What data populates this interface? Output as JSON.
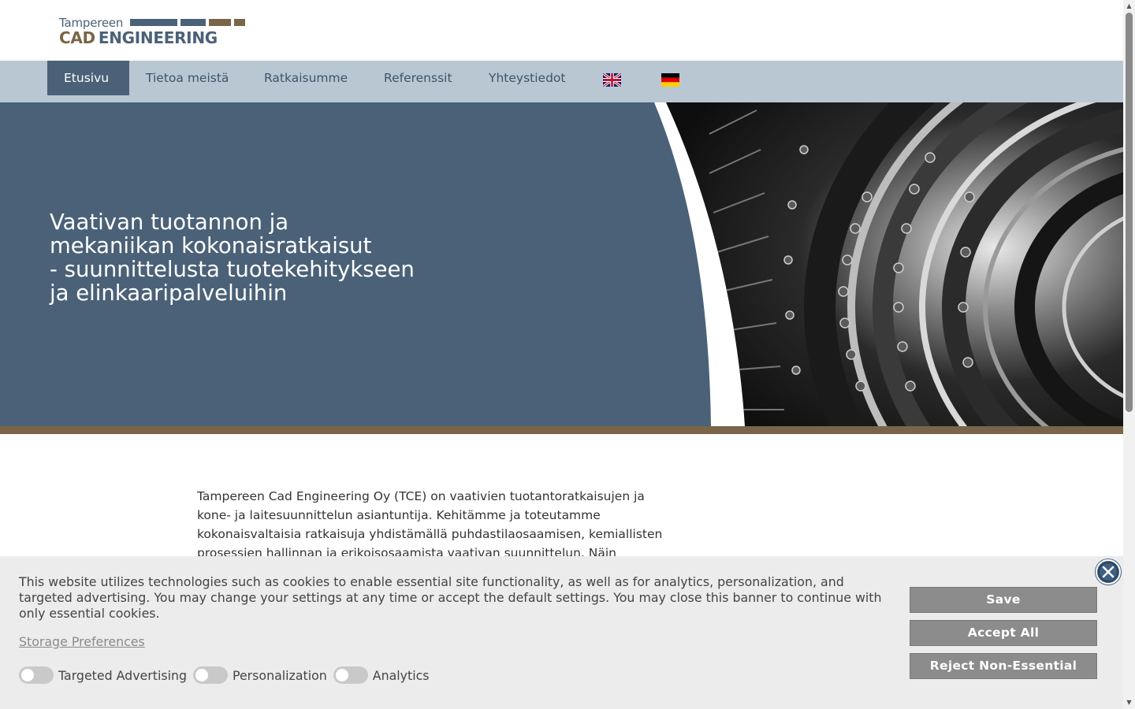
{
  "header": {
    "logo_line1": "Tampereen",
    "logo_cad": "CAD",
    "logo_engineering": "ENGINEERING"
  },
  "nav": {
    "items": [
      {
        "label": "Etusivu",
        "active": true
      },
      {
        "label": "Tietoa meistä",
        "active": false
      },
      {
        "label": "Ratkaisumme",
        "active": false
      },
      {
        "label": "Referenssit",
        "active": false
      },
      {
        "label": "Yhteystiedot",
        "active": false
      }
    ],
    "flags": [
      {
        "icon": "uk-flag-icon",
        "language": "English"
      },
      {
        "icon": "germany-flag-icon",
        "language": "Deutsch"
      }
    ]
  },
  "hero": {
    "title_lines": [
      "Vaativan tuotannon ja",
      "mekaniikan kokonaisratkaisut",
      "- suunnittelusta tuotekehitykseen",
      "ja elinkaaripalveluihin"
    ],
    "image_icon": "turbine-machinery-image"
  },
  "intro": {
    "text": "Tampereen Cad Engineering Oy (TCE) on vaativien tuotantoratkaisujen ja kone- ja laitesuunnittelun asiantuntija. Kehitämme ja toteutamme kokonaisvaltaisia ratkaisuja yhdistämällä puhdastilaosaamisen, kemiallisten prosessien hallinnan ja erikoisosaamista vaativan suunnittelun. Näin mahdollistamme, että asiakkaan"
  },
  "cookie_banner": {
    "text": "This website utilizes technologies such as cookies to enable essential site functionality, as well as for analytics, personalization, and targeted advertising. You may change your settings at any time or accept the default settings. You may close this banner to continue with only essential cookies.",
    "storage_link": "Storage Preferences",
    "toggles": [
      {
        "label": "Targeted Advertising",
        "on": false
      },
      {
        "label": "Personalization",
        "on": false
      },
      {
        "label": "Analytics",
        "on": false
      }
    ],
    "buttons": {
      "save": "Save",
      "accept_all": "Accept All",
      "reject": "Reject Non-Essential"
    },
    "close_icon": "close-icon"
  },
  "colors": {
    "brand_blue": "#4a6178",
    "brand_brown": "#7a6548",
    "nav_bg": "#b9c7d3",
    "banner_bg": "#ececec",
    "button_gray": "#8c8c8c",
    "close_blue": "#3f5f80"
  }
}
